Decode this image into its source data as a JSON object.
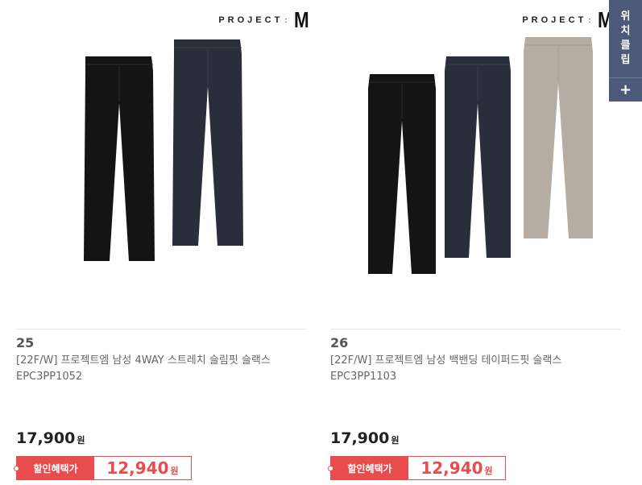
{
  "brand": {
    "name": "PROJECT",
    "sep": ":",
    "logo": "M"
  },
  "products": [
    {
      "rank": "25",
      "title": "[22F/W] 프로젝트엠 남성 4WAY 스트레치 슬림핏 슬랙스 EPC3PP1052",
      "price": "17,900",
      "price_unit": "원",
      "discount_label": "할인혜택가",
      "discount_price": "12,940",
      "discount_unit": "원"
    },
    {
      "rank": "26",
      "title": "[22F/W] 프로젝트엠 남성 백밴딩 테이퍼드핏 슬랙스 EPC3PP1103",
      "price": "17,900",
      "price_unit": "원",
      "discount_label": "할인혜택가",
      "discount_price": "12,940",
      "discount_unit": "원"
    }
  ],
  "sidebar": {
    "chars": [
      "위",
      "치",
      "클",
      "립"
    ],
    "plus": "+"
  },
  "colors": {
    "accent": "#e94c4c",
    "sidebar": "#4a5a78",
    "pants_black": "#141414",
    "pants_navy": "#2a2e3a",
    "pants_grey": "#b5aca4"
  }
}
